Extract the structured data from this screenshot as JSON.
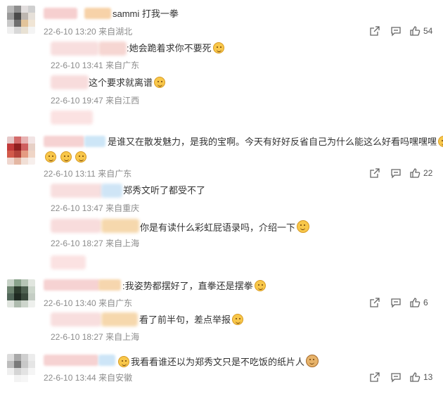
{
  "comments": [
    {
      "text": "sammi 打我一拳",
      "time": "22-6-10 13:20",
      "location": "来自湖北",
      "likes": "54",
      "replies": [
        {
          "text": ":她会跪着求你不要死",
          "time": "22-6-10 13:41",
          "location": "来自广东"
        },
        {
          "text": "这个要求就离谱",
          "time": "22-6-10 19:47",
          "location": "来自江西"
        }
      ]
    },
    {
      "text": "是谁又在散发魅力，是我的宝啊。今天有好好反省自己为什么能这么好看吗嘿嘿嘿",
      "time": "22-6-10 13:11",
      "location": "来自广东",
      "likes": "22",
      "replies": [
        {
          "text": "郑秀文听了都受不了",
          "time": "22-6-10 13:47",
          "location": "来自重庆"
        },
        {
          "text": "你是有读什么彩虹屁语录吗，介绍一下",
          "time": "22-6-10 18:27",
          "location": "来自上海"
        }
      ]
    },
    {
      "text": ":我姿势都摆好了，直拳还是摆拳",
      "time": "22-6-10 13:40",
      "location": "来自广东",
      "likes": "6",
      "replies": [
        {
          "text": "看了前半句，差点举报",
          "time": "22-6-10 18:27",
          "location": "来自上海"
        }
      ]
    },
    {
      "text": "我看看谁还以为郑秀文只是不吃饭的纸片人",
      "time": "22-6-10 13:44",
      "location": "来自安徽",
      "likes": "13",
      "replies": []
    }
  ],
  "icons": {
    "share": "share-icon",
    "comment": "comment-icon",
    "like": "thumbs-up-icon",
    "emoji": "smile-emoji-icon"
  }
}
